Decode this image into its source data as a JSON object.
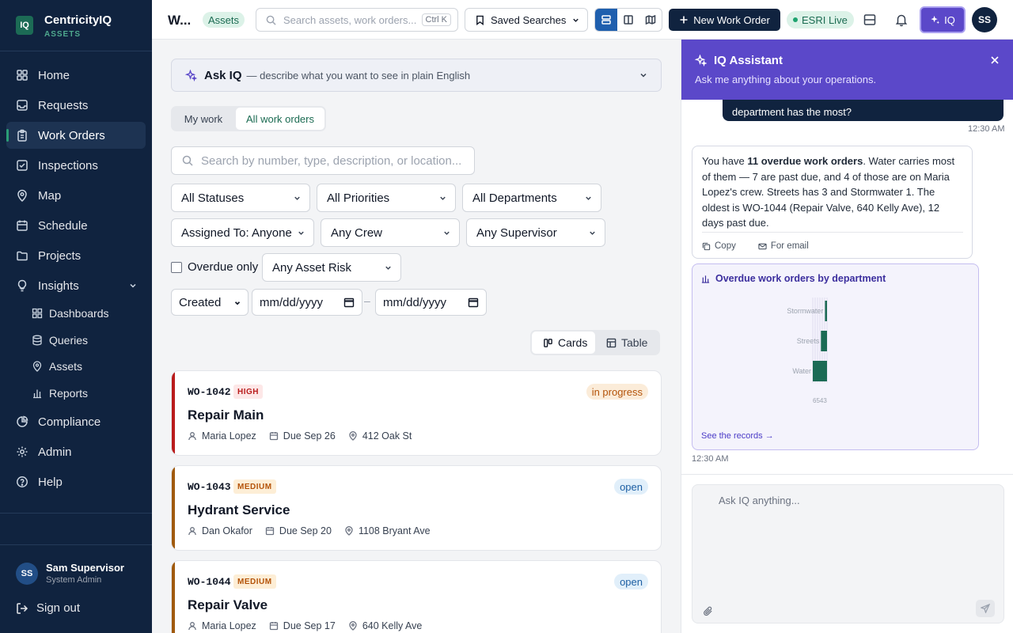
{
  "app": {
    "logo": "IQ",
    "name": "CentricityIQ",
    "module": "ASSETS"
  },
  "sidebar": {
    "items": [
      {
        "label": "Home"
      },
      {
        "label": "Requests"
      },
      {
        "label": "Work Orders"
      },
      {
        "label": "Inspections"
      },
      {
        "label": "Map"
      },
      {
        "label": "Schedule"
      },
      {
        "label": "Projects"
      },
      {
        "label": "Insights"
      },
      {
        "label": "Compliance"
      },
      {
        "label": "Admin"
      },
      {
        "label": "Help"
      }
    ],
    "insights_sub": [
      {
        "label": "Dashboards"
      },
      {
        "label": "Queries"
      },
      {
        "label": "Assets"
      },
      {
        "label": "Reports"
      }
    ],
    "active": "Work Orders",
    "user": {
      "initials": "SS",
      "name": "Sam Supervisor",
      "role": "System Admin"
    },
    "signout": "Sign out"
  },
  "header": {
    "title": "W...",
    "badge": "Assets",
    "search_placeholder": "Search assets, work orders...",
    "search_shortcut": "Ctrl K",
    "saved_searches": "Saved Searches",
    "new_work_order": "New Work Order",
    "esri": "ESRI Live",
    "iq_button": "IQ",
    "avatar": "SS"
  },
  "main": {
    "ask": {
      "title": "Ask IQ",
      "desc": "— describe what you want to see in plain English"
    },
    "tabs": [
      {
        "label": "My work"
      },
      {
        "label": "All work orders"
      }
    ],
    "search_placeholder": "Search by number, type, description, or location...",
    "filters": {
      "status": "All Statuses",
      "priority": "All Priorities",
      "department": "All Departments",
      "assigned": "Assigned To: Anyone",
      "crew": "Any Crew",
      "supervisor": "Any Supervisor",
      "overdue": "Overdue only",
      "risk": "Any Asset Risk",
      "date_field": "Created",
      "date_from": "mm/dd/yyyy",
      "date_to": "mm/dd/yyyy",
      "date_sep": "–"
    },
    "view": {
      "cards": "Cards",
      "table": "Table"
    },
    "work_orders": [
      {
        "number": "WO-1042",
        "priority": "HIGH",
        "status": "in progress",
        "title": "Repair Main",
        "assignee": "Maria Lopez",
        "due": "Due Sep 26",
        "location": "412 Oak St"
      },
      {
        "number": "WO-1043",
        "priority": "MEDIUM",
        "status": "open",
        "title": "Hydrant Service",
        "assignee": "Dan Okafor",
        "due": "Due Sep 20",
        "location": "1108 Bryant Ave"
      },
      {
        "number": "WO-1044",
        "priority": "MEDIUM",
        "status": "open",
        "title": "Repair Valve",
        "assignee": "Maria Lopez",
        "due": "Due Sep 17",
        "location": "640 Kelly Ave"
      }
    ]
  },
  "assistant": {
    "title": "IQ Assistant",
    "subtitle": "Ask me anything about your operations.",
    "user_message": "department has the most?",
    "user_time": "12:30 AM",
    "reply": {
      "p1": "You have ",
      "bold": "11 overdue work orders",
      "p2": ". Water carries most of them — 7 are past due, and 4 of those are on Maria Lopez's crew. Streets has 3 and Stormwater 1. The oldest is WO-1044 (Repair Valve, 640 Kelly Ave), 12 days past due."
    },
    "actions": {
      "copy": "Copy",
      "email": "For email"
    },
    "chart_title": "Overdue work orders by department",
    "see_records": "See the records →",
    "reply_time": "12:30 AM",
    "input_placeholder": "Ask IQ anything..."
  },
  "chart_data": {
    "type": "bar",
    "orientation": "horizontal",
    "title": "Overdue work orders by department",
    "categories": [
      "Stormwater",
      "Streets",
      "Water"
    ],
    "values": [
      1,
      3,
      7
    ],
    "tick_label_text": "6543",
    "colors": {
      "bar": "#1c6b55"
    }
  },
  "colors": {
    "brand": "#10233f",
    "accent": "#5b48c9",
    "green": "#1c6b55",
    "high": "#b91c1c",
    "medium": "#b45309"
  }
}
